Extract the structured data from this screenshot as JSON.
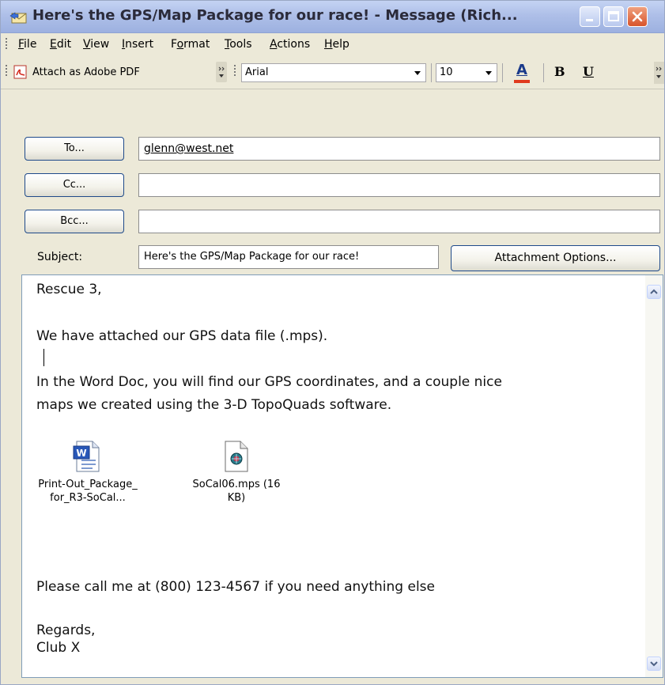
{
  "window": {
    "title": "Here's the GPS/Map Package for our race! - Message (Rich..."
  },
  "menu": [
    {
      "prefix": "",
      "ul": "F",
      "rest": "ile"
    },
    {
      "prefix": "",
      "ul": "E",
      "rest": "dit"
    },
    {
      "prefix": "",
      "ul": "V",
      "rest": "iew"
    },
    {
      "prefix": "",
      "ul": "I",
      "rest": "nsert"
    },
    {
      "prefix": "F",
      "ul": "o",
      "rest": "rmat"
    },
    {
      "prefix": "",
      "ul": "T",
      "rest": "ools"
    },
    {
      "prefix": "",
      "ul": "A",
      "rest": "ctions"
    },
    {
      "prefix": "",
      "ul": "H",
      "rest": "elp"
    }
  ],
  "toolbar": {
    "attach_pdf_label": "Attach as Adobe PDF",
    "font_name": "Arial",
    "font_size": "10",
    "bold_label": "B",
    "underline_label": "U",
    "font_color_label": "A",
    "font_color": "#e03a1e"
  },
  "address": {
    "to_button": "To...",
    "cc_button": "Cc...",
    "bcc_button": "Bcc...",
    "to_value": "glenn@west.net",
    "cc_value": "",
    "bcc_value": "",
    "subject_label": "Subject:",
    "subject_value": "Here's the GPS/Map Package for our race!",
    "attachment_options": "Attachment Options..."
  },
  "message": {
    "greeting": "Rescue 3,",
    "line1": "We have attached our GPS data file (.mps).",
    "line2": "In the Word Doc, you will find our GPS coordinates, and a couple nice",
    "line3": "maps we created using the 3-D TopoQuads software.",
    "call_line": "Please call me at (800) 123-4567 if you need anything else",
    "closing": "Regards,",
    "signature": "Club X"
  },
  "attachments": [
    {
      "icon": "word-document-icon",
      "line1": "Print-Out_Package_",
      "line2": "for_R3-SoCal..."
    },
    {
      "icon": "mps-file-icon",
      "line1": "SoCal06.mps (16",
      "line2": "KB)"
    }
  ]
}
